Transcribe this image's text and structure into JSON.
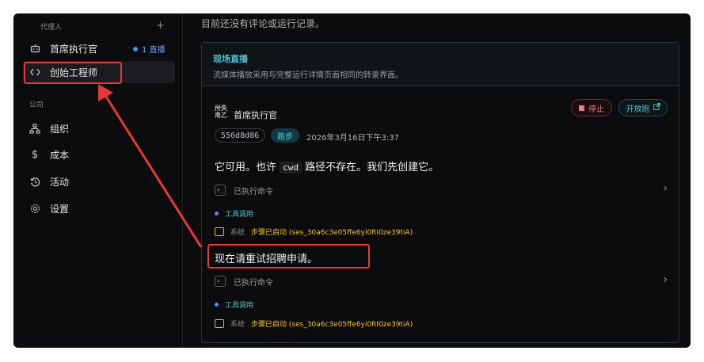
{
  "sidebar": {
    "agents_heading": "代理人",
    "add_symbol": "+",
    "agents": [
      {
        "label": "首席执行官",
        "icon": "robot-icon"
      },
      {
        "label": "创始工程师",
        "icon": "code-icon"
      }
    ],
    "live_badge": "1 直播",
    "company_heading": "公司",
    "company_items": [
      {
        "label": "组织",
        "icon": "org-chart-icon"
      },
      {
        "label": "成本",
        "icon": "dollar-icon"
      },
      {
        "label": "活动",
        "icon": "history-icon"
      },
      {
        "label": "设置",
        "icon": "gear-icon"
      }
    ]
  },
  "main": {
    "empty_text": "目前还没有评论或运行记录。",
    "panel": {
      "title": "现场直播",
      "subtitle": "流媒体播放采用与完整运行详情页面相同的转录界面。",
      "agent_name": "首席执行官",
      "stop_label": "停止",
      "open_label": "开放跑",
      "run_id": "556d8d86",
      "run_status": "跑步",
      "timestamp": "2026年3月16日下午3:37",
      "message1_before": "它可用。也许",
      "message1_code": "cwd",
      "message1_after": "路径不存在。我们先创建它。",
      "exec_label": "已执行命令",
      "tool_label": "工具调用",
      "sys_label": "系统",
      "sys_text": "步骤已启动 (ses_30a6c3e05ffe6yi0RI0ze39tiA)",
      "message2": "现在请重试招聘申请。"
    }
  },
  "colors": {
    "accent_cyan": "#4fc3d1",
    "stop_red": "#f07a80",
    "system_yellow": "#f0c23a",
    "annotation_red": "#e53935"
  }
}
